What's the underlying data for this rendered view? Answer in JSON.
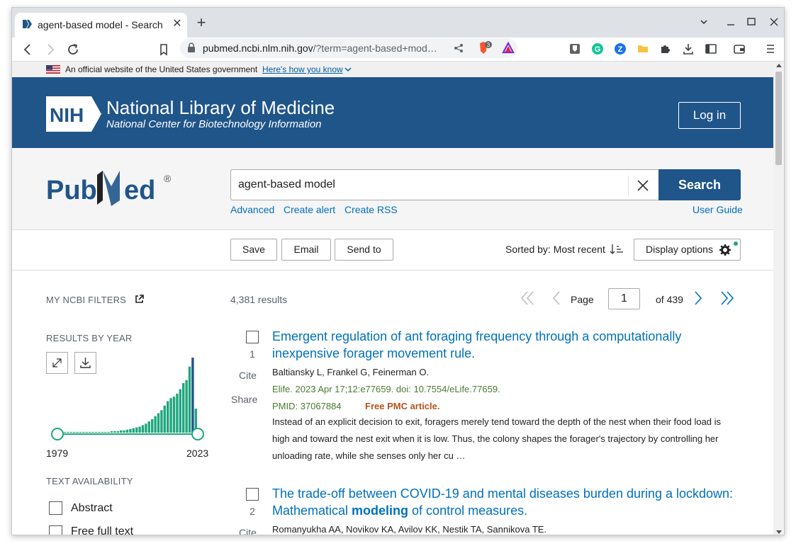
{
  "browser": {
    "tab_title": "agent-based model - Search Results - PubMed",
    "new_tab_glyph": "+",
    "close_glyph": "✕",
    "url_host": "pubmed.ncbi.nlm.nih.gov",
    "url_rest": "/?term=agent-based+mod…",
    "brave_badge": "3"
  },
  "gov_banner": {
    "text": "An official website of the United States government",
    "link": "Here's how you know"
  },
  "nlm_header": {
    "logo_text": "NIH",
    "title": "National Library of Medicine",
    "subtitle": "National Center for Biotechnology Information",
    "login": "Log in"
  },
  "search": {
    "logo": "PubMed",
    "query": "agent-based model",
    "button": "Search",
    "links": {
      "advanced": "Advanced",
      "create_alert": "Create alert",
      "create_rss": "Create RSS",
      "user_guide": "User Guide"
    }
  },
  "actions": {
    "save": "Save",
    "email": "Email",
    "send_to": "Send to",
    "sorted_by": "Sorted by: Most recent",
    "display_options": "Display options"
  },
  "sidebar": {
    "my_ncbi_filters": "MY NCBI FILTERS",
    "results_by_year": "RESULTS BY YEAR",
    "year_start": "1979",
    "year_end": "2023",
    "text_availability": "TEXT AVAILABILITY",
    "filters": [
      "Abstract",
      "Free full text"
    ]
  },
  "chart_data": {
    "type": "bar",
    "title": "RESULTS BY YEAR",
    "x_range": [
      "1979",
      "2023"
    ],
    "values": [
      1,
      1,
      1,
      1,
      1,
      1,
      1,
      1,
      1,
      1,
      1,
      1,
      1,
      1,
      1,
      1,
      1,
      2,
      2,
      2,
      3,
      3,
      4,
      5,
      6,
      7,
      8,
      10,
      12,
      15,
      18,
      22,
      26,
      30,
      36,
      42,
      46,
      48,
      52,
      58,
      66,
      70,
      88,
      100,
      32
    ],
    "accent": "#20a67e"
  },
  "results": {
    "count": "4,381 results",
    "page_label": "Page",
    "page_value": "1",
    "page_total": "of 439",
    "items": [
      {
        "num": "1",
        "cite": "Cite",
        "share": "Share",
        "title": "Emergent regulation of ant foraging frequency through a computationally inexpensive forager movement rule.",
        "authors": "Baltiansky L, Frankel G, Feinerman O.",
        "citation": "Elife. 2023 Apr 17;12:e77659. doi: 10.7554/eLife.77659.",
        "pmid": "PMID: 37067884",
        "free": "Free PMC article.",
        "snippet": "Instead of an explicit decision to exit, foragers merely tend toward the depth of the nest when their food load is high and toward the nest exit when it is low. Thus, the colony shapes the forager's trajectory by controlling her unloading rate, while she senses only her cu …"
      },
      {
        "num": "2",
        "cite": "Cite",
        "title_a": "The trade-off between COVID-19 and mental diseases burden during a lockdown: Mathematical ",
        "title_b": "modeling",
        "title_c": " of control measures.",
        "authors": "Romanyukha AA, Novikov KA, Avilov KK, Nestik TA, Sannikova TE."
      }
    ]
  }
}
